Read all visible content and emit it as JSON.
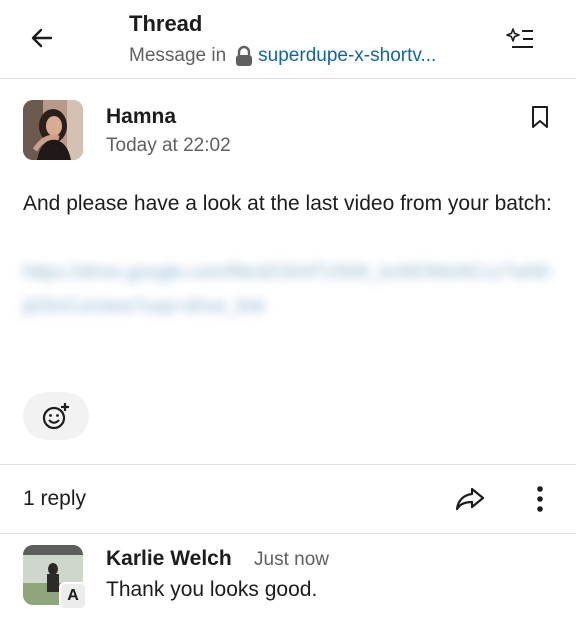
{
  "header": {
    "title": "Thread",
    "subtitle_prefix": "Message in",
    "channel": "superdupe-x-shortv...",
    "back_icon": "arrow-left-icon",
    "ai_icon": "sparkle-list-icon",
    "lock_icon": "lock-icon"
  },
  "parent_message": {
    "author": "Hamna",
    "timestamp": "Today at 22:02",
    "text": "And please have a look at the last video from your batch:",
    "link": "https://drive.google.com/file/d/1lH4Tz5tW_bcMOMxNCcz7wNhjtZ0nCo/view?usp=drive_link",
    "bookmark_icon": "bookmark-icon",
    "add_reaction_icon": "emoji-add-icon"
  },
  "replies_bar": {
    "count_label": "1 reply",
    "share_icon": "share-icon",
    "more_icon": "more-vertical-icon"
  },
  "reply": {
    "author": "Karlie Welch",
    "timestamp": "Just now",
    "text": "Thank you looks good.",
    "badge": "A"
  },
  "colors": {
    "link": "#1264a3",
    "muted": "#616061",
    "text": "#1d1c1d",
    "divider": "#e2e2e2"
  }
}
